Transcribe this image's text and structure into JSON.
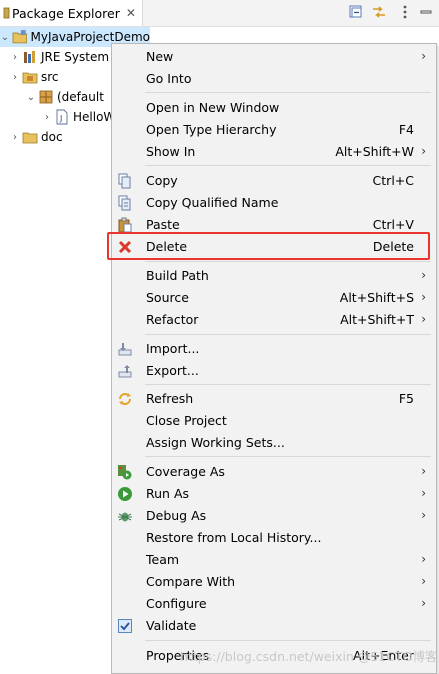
{
  "view": {
    "tab_title": "Package Explorer",
    "close_glyph": "✕"
  },
  "tree": [
    {
      "label": "MyJavaProjectDemo",
      "arrow": "⌄",
      "icon": "java-project-icon"
    },
    {
      "label": "JRE System",
      "arrow": "›",
      "icon": "library-icon"
    },
    {
      "label": "src",
      "arrow": "›",
      "icon": "source-folder-icon"
    },
    {
      "label": "(default",
      "arrow": "⌄",
      "icon": "package-icon"
    },
    {
      "label": "HelloW",
      "arrow": "›",
      "icon": "java-file-icon"
    },
    {
      "label": "doc",
      "arrow": "›",
      "icon": "folder-icon"
    }
  ],
  "menu": [
    {
      "label": "New",
      "shortcut": "",
      "submenu": true
    },
    {
      "label": "Go Into",
      "shortcut": "",
      "submenu": false
    },
    {
      "label": "Open in New Window",
      "shortcut": "",
      "submenu": false
    },
    {
      "label": "Open Type Hierarchy",
      "shortcut": "F4",
      "submenu": false
    },
    {
      "label": "Show In",
      "shortcut": "Alt+Shift+W",
      "submenu": true
    },
    {
      "label": "Copy",
      "shortcut": "Ctrl+C",
      "submenu": false
    },
    {
      "label": "Copy Qualified Name",
      "shortcut": "",
      "submenu": false
    },
    {
      "label": "Paste",
      "shortcut": "Ctrl+V",
      "submenu": false
    },
    {
      "label": "Delete",
      "shortcut": "Delete",
      "submenu": false
    },
    {
      "label": "Build Path",
      "shortcut": "",
      "submenu": true
    },
    {
      "label": "Source",
      "shortcut": "Alt+Shift+S",
      "submenu": true
    },
    {
      "label": "Refactor",
      "shortcut": "Alt+Shift+T",
      "submenu": true
    },
    {
      "label": "Import...",
      "shortcut": "",
      "submenu": false
    },
    {
      "label": "Export...",
      "shortcut": "",
      "submenu": false
    },
    {
      "label": "Refresh",
      "shortcut": "F5",
      "submenu": false
    },
    {
      "label": "Close Project",
      "shortcut": "",
      "submenu": false
    },
    {
      "label": "Assign Working Sets...",
      "shortcut": "",
      "submenu": false
    },
    {
      "label": "Coverage As",
      "shortcut": "",
      "submenu": true
    },
    {
      "label": "Run As",
      "shortcut": "",
      "submenu": true
    },
    {
      "label": "Debug As",
      "shortcut": "",
      "submenu": true
    },
    {
      "label": "Restore from Local History...",
      "shortcut": "",
      "submenu": false
    },
    {
      "label": "Team",
      "shortcut": "",
      "submenu": true
    },
    {
      "label": "Compare With",
      "shortcut": "",
      "submenu": true
    },
    {
      "label": "Configure",
      "shortcut": "",
      "submenu": true
    },
    {
      "label": "Validate",
      "shortcut": "",
      "submenu": false
    },
    {
      "label": "Properties",
      "shortcut": "Alt+Enter",
      "submenu": false
    }
  ],
  "submenu_glyph": "›",
  "highlighted_item": "Delete",
  "highlight_color": "#e8362f",
  "watermark": "https://blog.csdn.net/weixin @51CTO博客"
}
